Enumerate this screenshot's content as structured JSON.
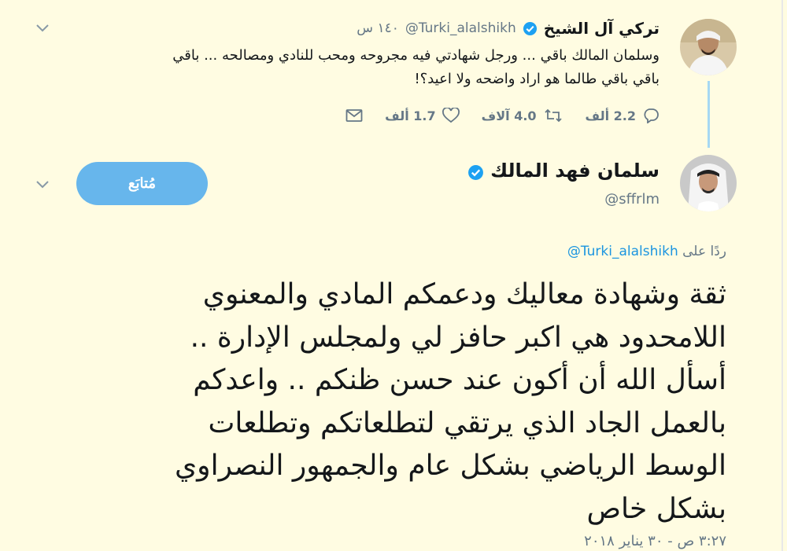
{
  "parent_tweet": {
    "name": "تركي آل الشيخ",
    "handle": "@Turki_alalshikh",
    "time": "١٤٠ س",
    "text_lines": [
      "وسلمان المالك باقي ... ورجل شهادتي فيه مجروحه ومحب للنادي ومصالحه ... باقي",
      "باقي باقي طالما هو اراد واضحه ولا اعيد؟!"
    ],
    "actions": {
      "reply_count": "2.2 ألف",
      "retweet_count": "4.0 آلاف",
      "like_count": "1.7 ألف"
    },
    "avatar_icon": "avatar-photo",
    "verified_icon": "verified-badge-icon"
  },
  "main_tweet": {
    "name": "سلمان فهد المالك",
    "handle": "@sffrlm",
    "follow_label": "مُتابَع",
    "reply_prefix": "ردًا على",
    "reply_link": "@Turki_alalshikh",
    "text_lines": [
      "ثقة وشهادة معاليك ودعمكم المادي والمعنوي",
      "اللامحدود هي اكبر حافز لي ولمجلس الإدارة ..",
      "أسأل الله أن أكون عند حسن ظنكم .. واعدكم",
      "بالعمل الجاد الذي يرتقي لتطلعاتكم وتطلعات",
      "الوسط الرياضي بشكل عام والجمهور النصراوي",
      "بشكل خاص"
    ],
    "timestamp": "٣:٢٧ ص - ٣٠ يناير ٢٠١٨"
  },
  "colors": {
    "background": "#fffce2",
    "accent": "#1b95e0",
    "follow_button": "#67b6ec",
    "muted_text": "#657786",
    "thread_line": "#a6d8f3"
  }
}
